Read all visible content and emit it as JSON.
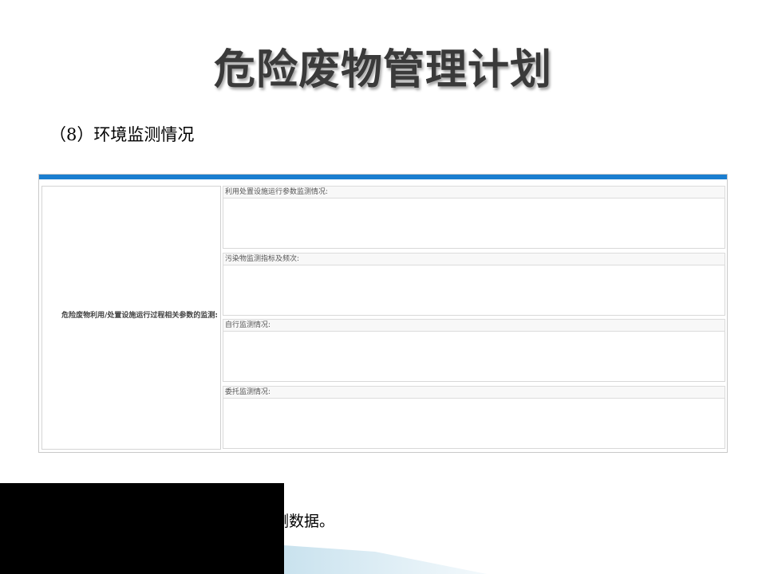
{
  "slide": {
    "title": "危险废物管理计划",
    "section_heading": "（8）环境监测情况",
    "note": "注：详细监测情况需附件附环境监测数据。"
  },
  "form": {
    "accent_color": "#1a7ed0",
    "row_label": "危险废物利用/处置设施运行过程相关参数的监测:",
    "fields": [
      {
        "label": "利用处置设施运行参数监测情况:",
        "value": ""
      },
      {
        "label": "污染物监测指标及频次:",
        "value": ""
      },
      {
        "label": "自行监测情况:",
        "value": ""
      },
      {
        "label": "委托监测情况:",
        "value": ""
      }
    ]
  }
}
